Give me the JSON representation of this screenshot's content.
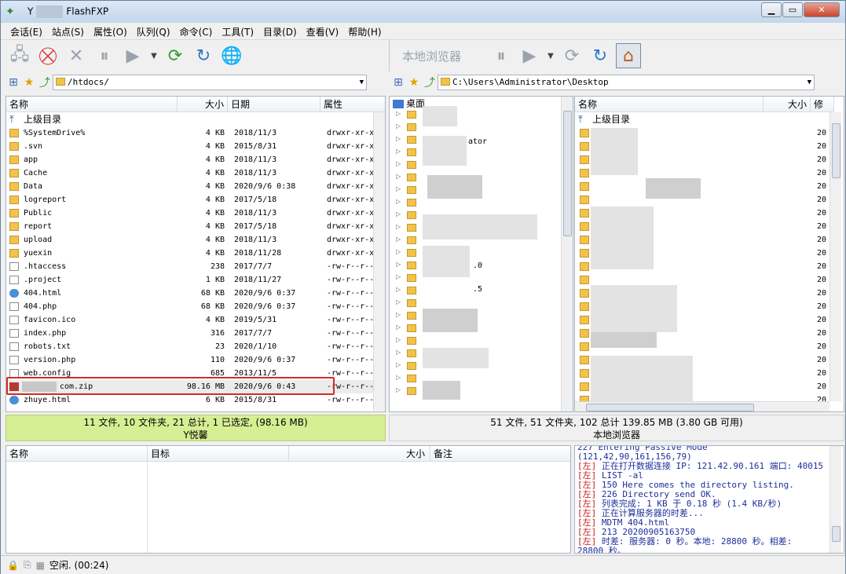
{
  "window": {
    "title_prefix": "Y",
    "title": "FlashFXP",
    "btn_min": "▁",
    "btn_max": "▭",
    "btn_close": "✕"
  },
  "menu": [
    "会话(E)",
    "站点(S)",
    "属性(O)",
    "队列(Q)",
    "命令(C)",
    "工具(T)",
    "目录(D)",
    "查看(V)",
    "帮助(H)"
  ],
  "right_toolbar_label": "本地浏览器",
  "left_path": "/htdocs/",
  "right_path": "C:\\Users\\Administrator\\Desktop",
  "left_headers": {
    "name": "名称",
    "size": "大小",
    "date": "日期",
    "attr": "属性"
  },
  "left_parent": "上级目录",
  "left_files": [
    {
      "name": "%SystemDrive%",
      "size": "4 KB",
      "date": "2018/11/3",
      "attr": "drwxr-xr-x",
      "type": "folder"
    },
    {
      "name": ".svn",
      "size": "4 KB",
      "date": "2015/8/31",
      "attr": "drwxr-xr-x",
      "type": "folder"
    },
    {
      "name": "app",
      "size": "4 KB",
      "date": "2018/11/3",
      "attr": "drwxr-xr-x",
      "type": "folder"
    },
    {
      "name": "Cache",
      "size": "4 KB",
      "date": "2018/11/3",
      "attr": "drwxr-xr-x",
      "type": "folder"
    },
    {
      "name": "Data",
      "size": "4 KB",
      "date": "2020/9/6 0:38",
      "attr": "drwxr-xr-x",
      "type": "folder"
    },
    {
      "name": "logreport",
      "size": "4 KB",
      "date": "2017/5/18",
      "attr": "drwxr-xr-x",
      "type": "folder"
    },
    {
      "name": "Public",
      "size": "4 KB",
      "date": "2018/11/3",
      "attr": "drwxr-xr-x",
      "type": "folder"
    },
    {
      "name": "report",
      "size": "4 KB",
      "date": "2017/5/18",
      "attr": "drwxr-xr-x",
      "type": "folder"
    },
    {
      "name": "upload",
      "size": "4 KB",
      "date": "2018/11/3",
      "attr": "drwxr-xr-x",
      "type": "folder"
    },
    {
      "name": "yuexin",
      "size": "4 KB",
      "date": "2018/11/28",
      "attr": "drwxr-xr-x",
      "type": "folder"
    },
    {
      "name": ".htaccess",
      "size": "238",
      "date": "2017/7/7",
      "attr": "-rw-r--r--",
      "type": "file"
    },
    {
      "name": ".project",
      "size": "1 KB",
      "date": "2018/11/27",
      "attr": "-rw-r--r--",
      "type": "file"
    },
    {
      "name": "404.html",
      "size": "68 KB",
      "date": "2020/9/6 0:37",
      "attr": "-rw-r--r--",
      "type": "web"
    },
    {
      "name": "404.php",
      "size": "68 KB",
      "date": "2020/9/6 0:37",
      "attr": "-rw-r--r--",
      "type": "file"
    },
    {
      "name": "favicon.ico",
      "size": "4 KB",
      "date": "2019/5/31",
      "attr": "-rw-r--r--",
      "type": "file"
    },
    {
      "name": "index.php",
      "size": "316",
      "date": "2017/7/7",
      "attr": "-rw-r--r--",
      "type": "file"
    },
    {
      "name": "robots.txt",
      "size": "23",
      "date": "2020/1/10",
      "attr": "-rw-r--r--",
      "type": "file"
    },
    {
      "name": "version.php",
      "size": "110",
      "date": "2020/9/6 0:37",
      "attr": "-rw-r--r--",
      "type": "file"
    },
    {
      "name": "web.config",
      "size": "685",
      "date": "2013/11/5",
      "attr": "-rw-r--r--",
      "type": "file"
    },
    {
      "name": "com.zip",
      "size": "98.16 MB",
      "date": "2020/9/6 0:43",
      "attr": "-rw-r--r--",
      "type": "zip"
    },
    {
      "name": "zhuye.html",
      "size": "6 KB",
      "date": "2015/8/31",
      "attr": "-rw-r--r--",
      "type": "web"
    }
  ],
  "tree_root": "桌面",
  "tree_fragments": [
    "ator",
    ".0",
    ".5"
  ],
  "right_headers": {
    "name": "名称",
    "size": "大小",
    "date": "修"
  },
  "right_parent": "上级目录",
  "right_dates_prefix": "20",
  "left_status": {
    "summary": "11 文件, 10 文件夹, 21 总计, 1 已选定, (98.16 MB)",
    "site": "Y悦馨"
  },
  "right_status": {
    "summary": "51 文件, 51 文件夹, 102 总计 139.85 MB (3.80 GB 可用)",
    "site": "本地浏览器"
  },
  "queue_headers": {
    "name": "名称",
    "target": "目标",
    "size": "大小",
    "note": "备注"
  },
  "log": [
    {
      "p": "",
      "t": "227 Entering Passive Mode"
    },
    {
      "p": "",
      "t": "(121,42,90,161,156,79)"
    },
    {
      "p": "[左]",
      "t": " 正在打开数据连接 IP: 121.42.90.161 端口: 40015"
    },
    {
      "p": "[左]",
      "t": " LIST -al"
    },
    {
      "p": "[左]",
      "t": " 150 Here comes the directory listing."
    },
    {
      "p": "[左]",
      "t": " 226 Directory send OK."
    },
    {
      "p": "[左]",
      "t": " 列表完成: 1 KB 于 0.18 秒 (1.4 KB/秒)"
    },
    {
      "p": "[左]",
      "t": " 正在计算服务器的时差..."
    },
    {
      "p": "[左]",
      "t": " MDTM 404.html"
    },
    {
      "p": "[左]",
      "t": " 213 20200905163750"
    },
    {
      "p": "[左]",
      "t": " 时差: 服务器: 0 秒。本地: 28800 秒。相差:"
    },
    {
      "p": "",
      "t": "28800 秒。"
    }
  ],
  "bottom_status": "空闲. (00:24)"
}
